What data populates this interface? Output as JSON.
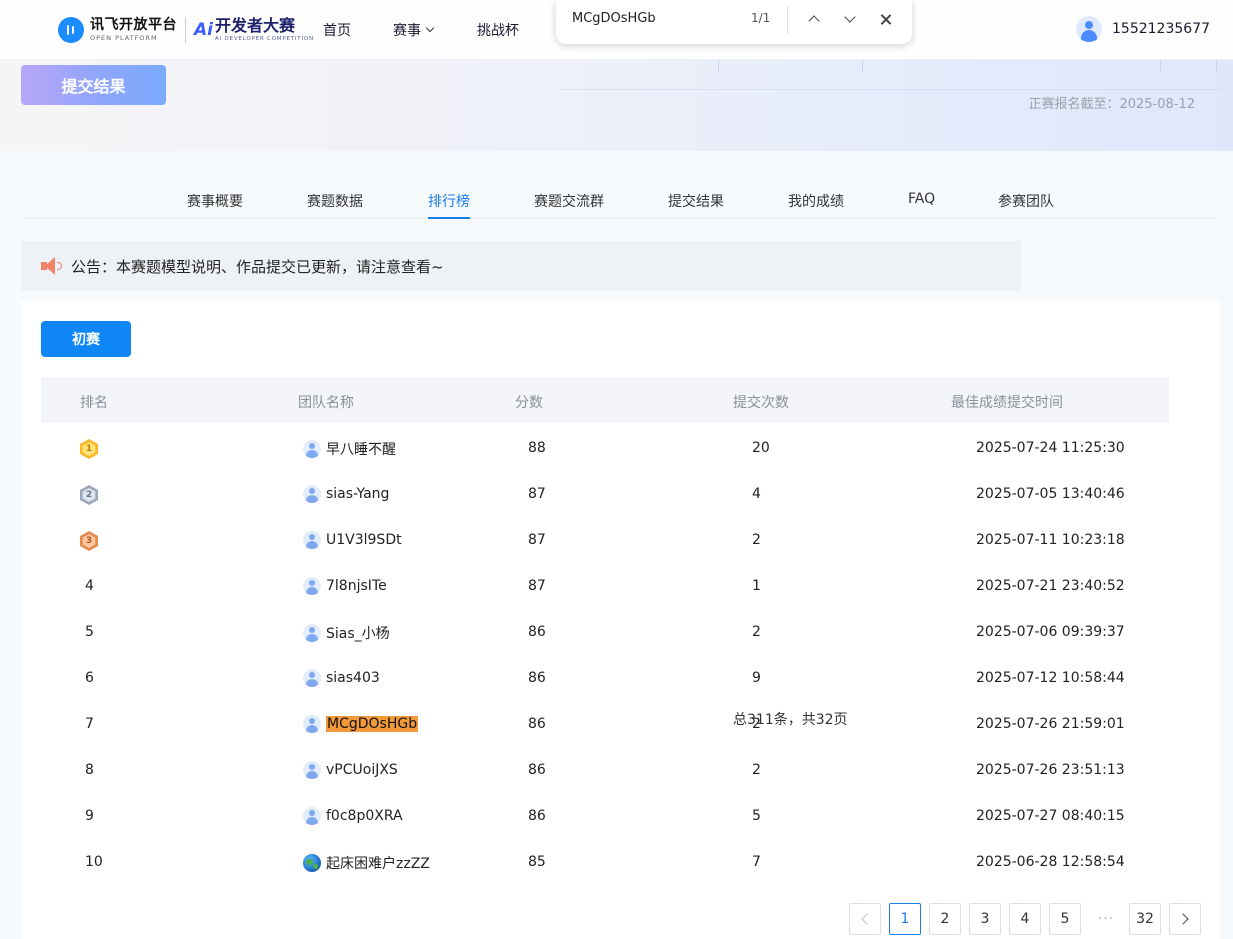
{
  "header": {
    "logo_cn": "讯飞开放平台",
    "logo_en": "OPEN PLATFORM",
    "contest_mark": "Ai",
    "contest_cn": "开发者大赛",
    "contest_en": "AI DEVELOPER COMPETITION",
    "nav": {
      "home": "首页",
      "events": "赛事",
      "cup": "挑战杯"
    },
    "user_phone": "15521235677"
  },
  "findbar": {
    "query": "MCgDOsHGb",
    "count": "1/1"
  },
  "banner": {
    "submit_label": "提交结果",
    "deadline": "正赛报名截至：2025-08-12"
  },
  "tabs": [
    "赛事概要",
    "赛题数据",
    "排行榜",
    "赛题交流群",
    "提交结果",
    "我的成绩",
    "FAQ",
    "参赛团队"
  ],
  "active_tab": "排行榜",
  "notice": "公告：本赛题模型说明、作品提交已更新，请注意查看~",
  "round_label": "初赛",
  "table": {
    "headers": {
      "rank": "排名",
      "team": "团队名称",
      "score": "分数",
      "count": "提交次数",
      "time": "最佳成绩提交时间"
    },
    "rows": [
      {
        "rank": "1",
        "team": "早八睡不醒",
        "score": "88",
        "count": "20",
        "time": "2025-07-24 11:25:30"
      },
      {
        "rank": "2",
        "team": "sias-Yang",
        "score": "87",
        "count": "4",
        "time": "2025-07-05 13:40:46"
      },
      {
        "rank": "3",
        "team": "U1V3l9SDt",
        "score": "87",
        "count": "2",
        "time": "2025-07-11 10:23:18"
      },
      {
        "rank": "4",
        "team": "7l8njsITe",
        "score": "87",
        "count": "1",
        "time": "2025-07-21 23:40:52"
      },
      {
        "rank": "5",
        "team": "Sias_小杨",
        "score": "86",
        "count": "2",
        "time": "2025-07-06 09:39:37"
      },
      {
        "rank": "6",
        "team": "sias403",
        "score": "86",
        "count": "9",
        "time": "2025-07-12 10:58:44"
      },
      {
        "rank": "7",
        "team": "MCgDOsHGb",
        "score": "86",
        "count": "2",
        "time": "2025-07-26 21:59:01"
      },
      {
        "rank": "8",
        "team": "vPCUoiJXS",
        "score": "86",
        "count": "2",
        "time": "2025-07-26 23:51:13"
      },
      {
        "rank": "9",
        "team": "f0c8p0XRA",
        "score": "86",
        "count": "5",
        "time": "2025-07-27 08:40:15"
      },
      {
        "rank": "10",
        "team": "起床困难户zzZZ",
        "score": "85",
        "count": "7",
        "time": "2025-06-28 12:58:54"
      }
    ]
  },
  "pagination": {
    "total": "总311条，共32页",
    "pages": [
      "1",
      "2",
      "3",
      "4",
      "5"
    ],
    "dots": "···",
    "last": "32",
    "current": "1"
  },
  "colors": {
    "accent": "#1a7fe8",
    "primary_button": "#0f86f5",
    "highlight": "#f29a3a"
  }
}
